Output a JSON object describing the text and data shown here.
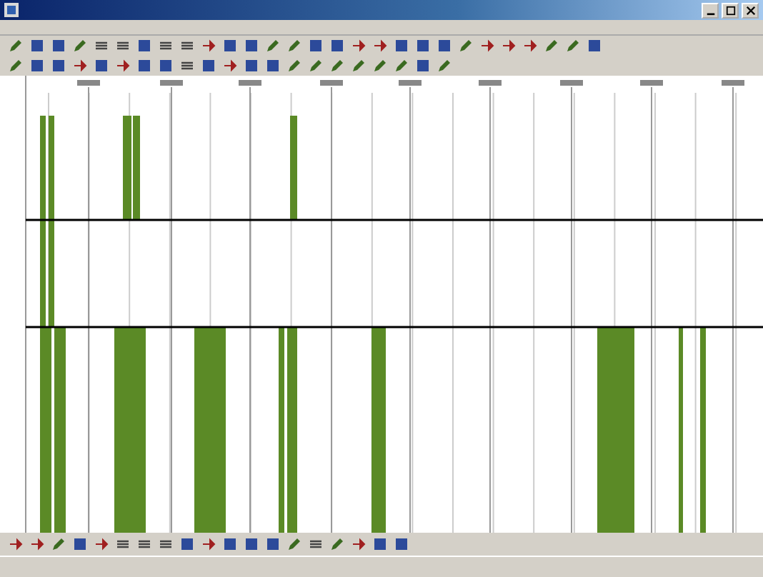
{
  "window": {
    "controls": [
      {
        "kind": "minimize"
      },
      {
        "kind": "maximize"
      },
      {
        "kind": "close"
      }
    ]
  },
  "toolbars": [
    {
      "buttons": [
        {
          "kind": "pencil"
        },
        {
          "kind": "square"
        },
        {
          "kind": "square"
        },
        {
          "kind": "pencil"
        },
        {
          "kind": "lines"
        },
        {
          "kind": "lines"
        },
        {
          "kind": "square"
        },
        {
          "kind": "lines"
        },
        {
          "kind": "lines"
        },
        {
          "kind": "arrow"
        },
        {
          "kind": "square"
        },
        {
          "kind": "square"
        },
        {
          "kind": "pencil"
        },
        {
          "kind": "pencil"
        },
        {
          "kind": "square"
        },
        {
          "kind": "square"
        },
        {
          "kind": "arrow"
        },
        {
          "kind": "arrow"
        },
        {
          "kind": "square"
        },
        {
          "kind": "square"
        },
        {
          "kind": "square"
        },
        {
          "kind": "pencil"
        },
        {
          "kind": "arrow"
        },
        {
          "kind": "arrow"
        },
        {
          "kind": "arrow"
        },
        {
          "kind": "pencil"
        },
        {
          "kind": "pencil"
        },
        {
          "kind": "square"
        }
      ]
    },
    {
      "buttons": [
        {
          "kind": "pencil"
        },
        {
          "kind": "square"
        },
        {
          "kind": "square"
        },
        {
          "kind": "arrow"
        },
        {
          "kind": "square"
        },
        {
          "kind": "arrow"
        },
        {
          "kind": "square"
        },
        {
          "kind": "square"
        },
        {
          "kind": "lines"
        },
        {
          "kind": "square"
        },
        {
          "kind": "arrow"
        },
        {
          "kind": "square"
        },
        {
          "kind": "square"
        },
        {
          "kind": "pencil"
        },
        {
          "kind": "pencil"
        },
        {
          "kind": "pencil"
        },
        {
          "kind": "pencil"
        },
        {
          "kind": "pencil"
        },
        {
          "kind": "pencil"
        },
        {
          "kind": "square"
        },
        {
          "kind": "pencil"
        }
      ]
    },
    {
      "buttons": [
        {
          "kind": "arrow"
        },
        {
          "kind": "arrow"
        },
        {
          "kind": "pencil"
        },
        {
          "kind": "square"
        },
        {
          "kind": "arrow"
        },
        {
          "kind": "lines"
        },
        {
          "kind": "lines"
        },
        {
          "kind": "lines"
        },
        {
          "kind": "square"
        },
        {
          "kind": "arrow"
        },
        {
          "kind": "square"
        },
        {
          "kind": "square"
        },
        {
          "kind": "square"
        },
        {
          "kind": "pencil"
        },
        {
          "kind": "lines"
        },
        {
          "kind": "pencil"
        },
        {
          "kind": "arrow"
        },
        {
          "kind": "square"
        },
        {
          "kind": "square"
        }
      ]
    }
  ]
}
